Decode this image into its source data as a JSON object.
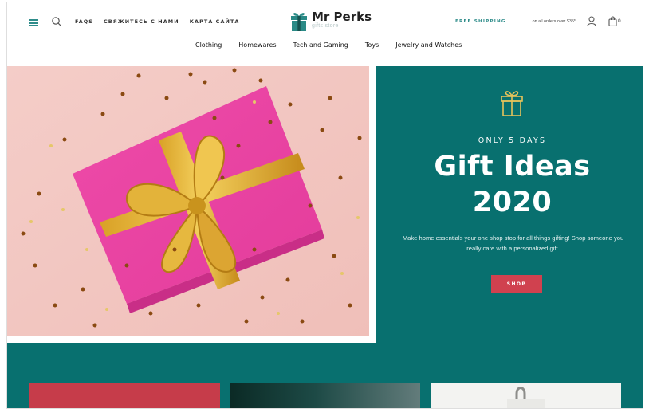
{
  "header": {
    "top_links": [
      "FAQS",
      "СВЯЖИТЕСЬ С НАМИ",
      "КАРТА САЙТА"
    ],
    "brand": "Mr Perks",
    "tagline": "gifts store",
    "shipping_label": "FREE SHIPPING",
    "shipping_note": "on all orders over $35*",
    "cart_count": "0",
    "brand_color": "#2e8c8a"
  },
  "nav": {
    "items": [
      "Clothing",
      "Homewares",
      "Tech and Gaming",
      "Toys",
      "Jewelry and Watches"
    ]
  },
  "hero": {
    "eyebrow": "ONLY 5 DAYS",
    "headline_line1": "Gift Ideas",
    "headline_line2": "2020",
    "blurb": "Make home essentials your one shop stop for all things gifting! Shop someone you really care with a personalized gift.",
    "button": "SHOP",
    "background_color": "#08706f",
    "button_color": "#d0414f"
  },
  "icons": {
    "menu": "hamburger-icon",
    "search": "search-icon",
    "account": "user-icon",
    "cart": "shopping-bag-icon",
    "promo": "gift-box-icon"
  }
}
